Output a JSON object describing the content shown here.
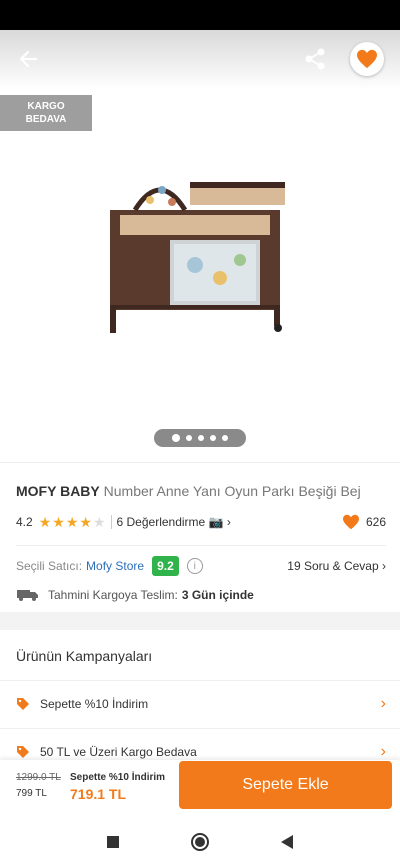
{
  "badge": {
    "line1": "KARGO",
    "line2": "BEDAVA"
  },
  "product": {
    "brand": "MOFY BABY",
    "name": "Number Anne Yanı Oyun Parkı Beşiği Bej",
    "rating": "4.2",
    "rating_value": 4.2,
    "reviews_label": "6 Değerlendirme",
    "likes": "626"
  },
  "seller": {
    "label": "Seçili Satıcı:",
    "name": "Mofy Store",
    "score": "9.2",
    "qa_label": "19 Soru & Cevap"
  },
  "delivery": {
    "label": "Tahmini Kargoya Teslim:",
    "value": "3 Gün içinde"
  },
  "campaigns": {
    "title": "Ürünün Kampanyaları",
    "items": [
      {
        "label": "Sepette %10 İndirim"
      },
      {
        "label": "50 TL ve Üzeri Kargo Bedava"
      }
    ]
  },
  "pricing": {
    "old_price": "1299.0 TL",
    "price": "799 TL",
    "promo": "Sepette %10 İndirim",
    "final_price": "719.1 TL"
  },
  "cart_button": "Sepete Ekle",
  "colors": {
    "accent": "#f27a1a",
    "score": "#2fb34a",
    "link": "#2d6fb8"
  },
  "gallery": {
    "image_count": 5,
    "active_index": 0
  }
}
